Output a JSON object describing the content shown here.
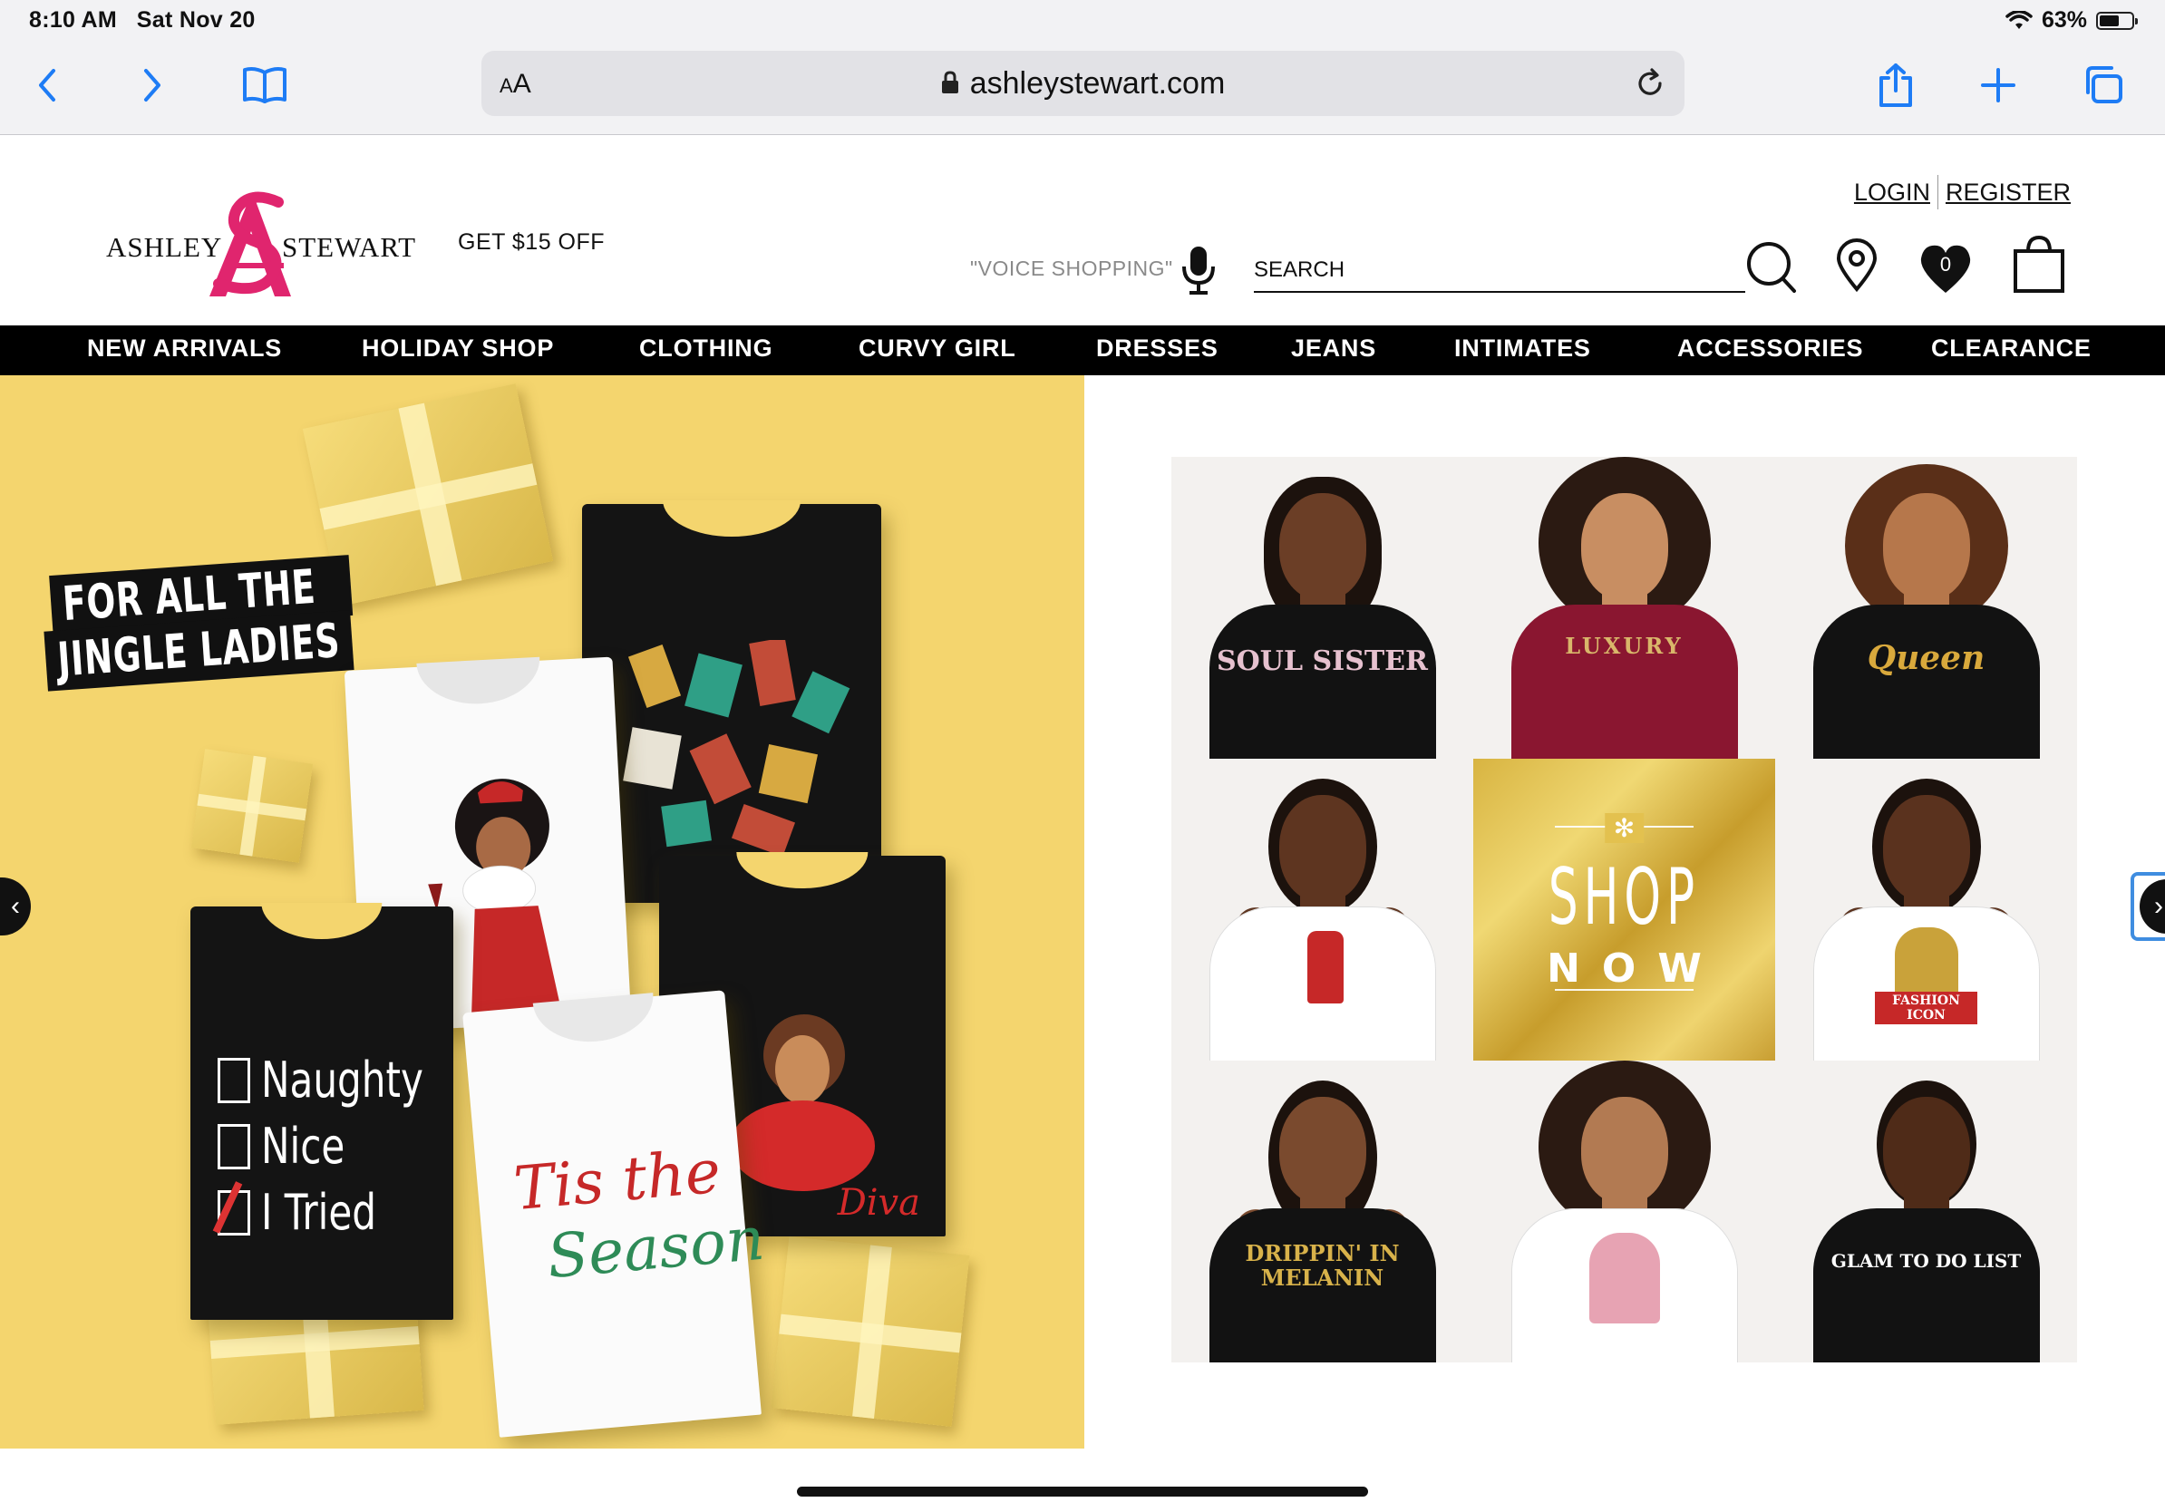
{
  "status": {
    "time": "8:10 AM",
    "date": "Sat Nov 20",
    "battery": "63%",
    "battery_level": 0.63
  },
  "browser": {
    "aa_label": "AA",
    "url": "ashleystewart.com"
  },
  "header": {
    "logo_left": "ASHLEY",
    "logo_right": "STEWART",
    "logo_mark": "AS",
    "promo": "GET $15 OFF",
    "login": "LOGIN",
    "register": "REGISTER",
    "voice_label": "\"VOICE SHOPPING\"",
    "search_placeholder": "SEARCH",
    "wishlist_count": "0"
  },
  "nav": {
    "items": [
      "NEW ARRIVALS",
      "HOLIDAY SHOP",
      "CLOTHING",
      "CURVY GIRL",
      "DRESSES",
      "JEANS",
      "INTIMATES",
      "ACCESSORIES",
      "CLEARANCE"
    ]
  },
  "hero_left": {
    "headline_line1": "FOR ALL THE",
    "headline_line2": "JINGLE LADIES",
    "shirt_list": [
      "Naughty",
      "Nice",
      "I Tried"
    ],
    "shirt_season_1": "Tis the",
    "shirt_season_2": "Season",
    "shirt_diva": "Diva"
  },
  "hero_right": {
    "tiles": [
      "SOUL SISTER",
      "LUXURY",
      "Queen",
      "",
      "",
      "FASHION ICON",
      "DRIPPIN' IN MELANIN",
      "",
      "GLAM TO DO LIST"
    ],
    "shop_line1": "SHOP",
    "shop_line2": "NOW"
  },
  "colors": {
    "brand_pink": "#e0256e",
    "nav_bg": "#000000",
    "hero_yellow": "#f4d56e",
    "safari_blue": "#1e7cf5"
  },
  "icons": [
    "back-icon",
    "forward-icon",
    "bookmarks-icon",
    "lock-icon",
    "reload-icon",
    "share-icon",
    "new-tab-icon",
    "tabs-icon",
    "mic-icon",
    "search-icon",
    "location-pin-icon",
    "heart-icon",
    "shopping-bag-icon"
  ]
}
